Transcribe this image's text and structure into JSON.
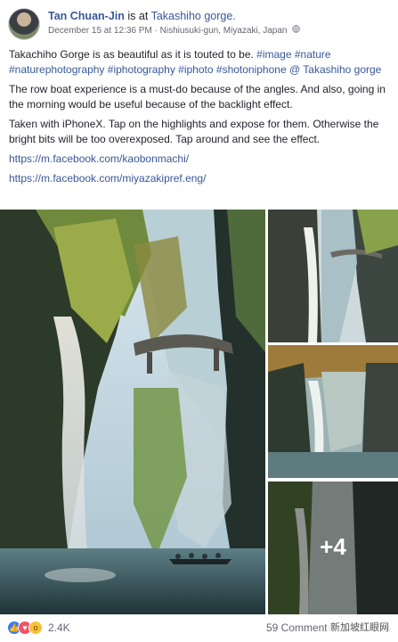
{
  "post": {
    "author": "Tan Chuan-Jin",
    "is_at": "is at",
    "place": "Takashiho gorge.",
    "date": "December 15 at 12:36 PM",
    "separator": "·",
    "location": "Nishiusuki-gun, Miyazaki, Japan",
    "privacy_icon": "globe-icon"
  },
  "body": {
    "p1_text": "Takachiho Gorge is as beautiful as it is touted to be. ",
    "hashtags": [
      "#image",
      "#nature",
      "#naturephotography",
      "#iphotography",
      "#iphoto",
      "#shotoniphone"
    ],
    "p1_at": "@ Takashiho gorge",
    "p2": "The row boat experience is a must-do because of the angles. And also, going in the morning would be useful because of the backlight effect.",
    "p3": "Taken with iPhoneX. Tap on the highlights and expose for them. Otherwise the bright bits will be too overexposed. Tap around and see the effect.",
    "link1": "https://m.facebook.com/kaobonmachi/",
    "link2": "https://m.facebook.com/miyazakipref.eng/"
  },
  "photos": {
    "more_count": "+4"
  },
  "footer": {
    "reaction_icons": [
      "like-icon",
      "love-icon",
      "wow-icon"
    ],
    "reaction_count": "2.4K",
    "comments": "59 Comments · 54 Shares",
    "watermark": "新加坡红眼网"
  },
  "colors": {
    "link": "#385898",
    "text": "#1d2129",
    "meta": "#616770"
  }
}
